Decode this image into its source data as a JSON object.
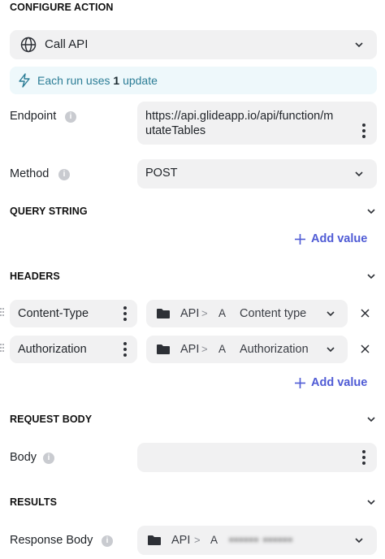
{
  "configure": {
    "title": "CONFIGURE ACTION",
    "action_value": "Call API",
    "updates_prefix": "Each run uses",
    "updates_count": "1",
    "updates_suffix": "update"
  },
  "endpoint": {
    "label": "Endpoint",
    "value_line1": "https://api.glideapp.io/api/function/m",
    "value_line2": "utateTables"
  },
  "method": {
    "label": "Method",
    "value": "POST"
  },
  "query_string": {
    "title": "QUERY STRING",
    "add_label": "Add value"
  },
  "headers": {
    "title": "HEADERS",
    "rows": [
      {
        "key": "Content-Type",
        "source": "API",
        "separator": ">",
        "type_icon": "A",
        "column": "Content type"
      },
      {
        "key": "Authorization",
        "source": "API",
        "separator": ">",
        "type_icon": "A",
        "column": "Authorization"
      }
    ],
    "add_label": "Add value"
  },
  "request_body": {
    "title": "REQUEST BODY",
    "label": "Body",
    "value": ""
  },
  "results": {
    "title": "RESULTS",
    "label": "Response Body",
    "source": "API",
    "separator": ">",
    "type_icon": "A",
    "column": "▪▪▪▪▪▪ ▪▪▪▪▪▪"
  },
  "colors": {
    "accent": "#4f5bd5",
    "info_banner_bg": "#eef8fb",
    "info_banner_text": "#2c7d96",
    "field_bg": "#f1f1f2"
  }
}
